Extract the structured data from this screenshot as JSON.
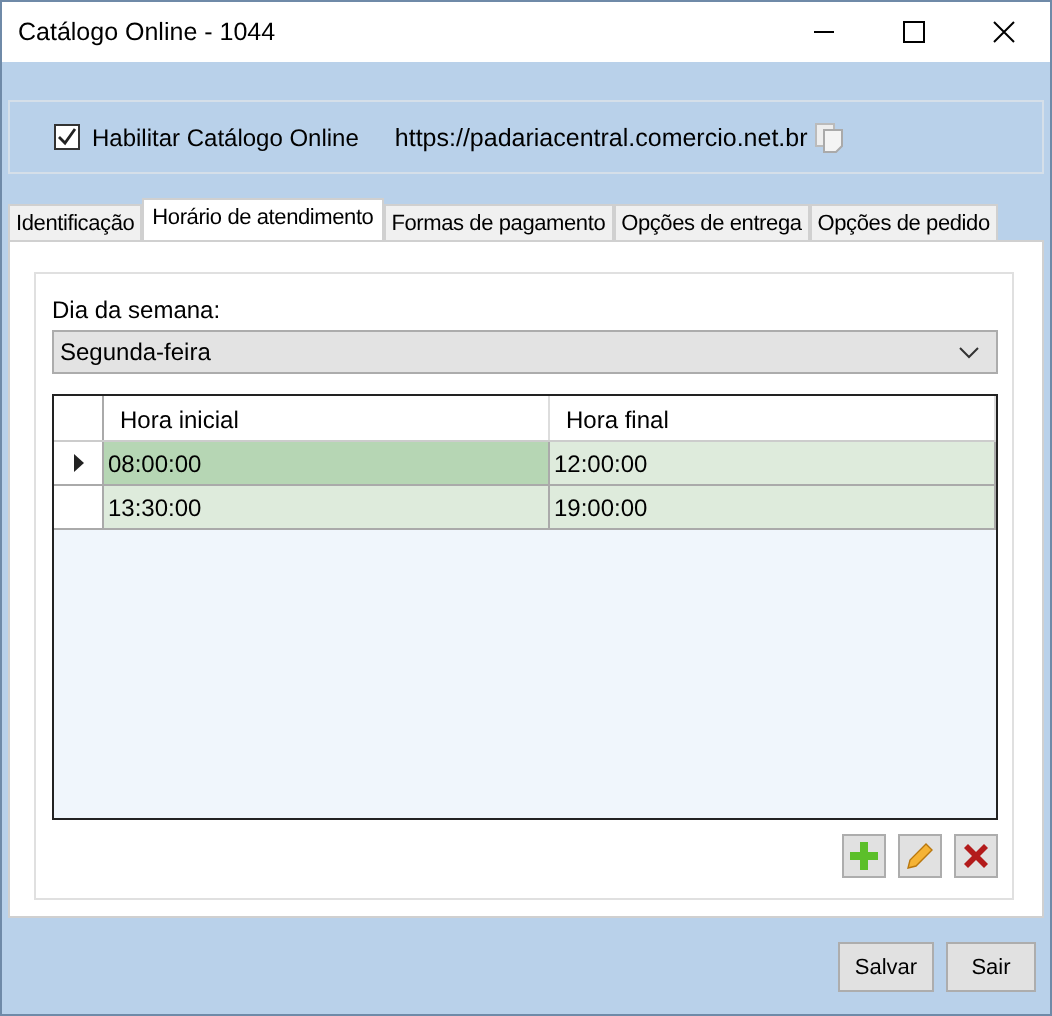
{
  "window": {
    "title": "Catálogo Online - 1044"
  },
  "catalog": {
    "enabled_label": "Habilitar Catálogo Online",
    "checked": true,
    "url": "https://padariacentral.comercio.net.br"
  },
  "tabs": [
    {
      "label": "Identificação",
      "selected": false
    },
    {
      "label": "Horário de atendimento",
      "selected": true
    },
    {
      "label": "Formas de pagamento",
      "selected": false
    },
    {
      "label": "Opções de entrega",
      "selected": false
    },
    {
      "label": "Opções de pedido",
      "selected": false
    }
  ],
  "weekday": {
    "label": "Dia da semana:",
    "value": "Segunda-feira"
  },
  "table": {
    "columns": [
      "Hora inicial",
      "Hora final"
    ],
    "rows": [
      {
        "cells": [
          "08:00:00",
          "12:00:00"
        ],
        "selected": true
      },
      {
        "cells": [
          "13:30:00",
          "19:00:00"
        ],
        "selected": false
      }
    ]
  },
  "buttons": [
    "Salvar",
    "Sair"
  ]
}
